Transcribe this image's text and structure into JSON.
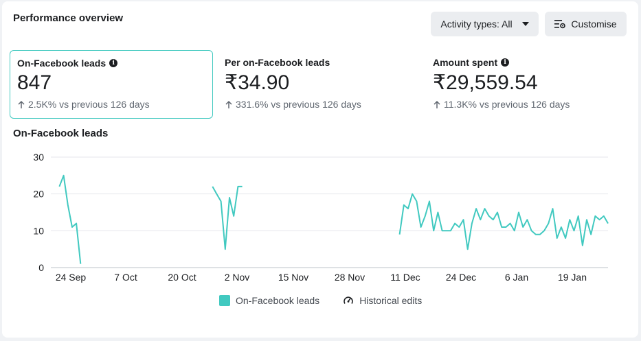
{
  "header": {
    "title": "Performance overview",
    "activity_label": "Activity types: All",
    "customise_label": "Customise"
  },
  "metrics": [
    {
      "label": "On-Facebook leads",
      "value": "847",
      "delta": "2.5K% vs previous 126 days",
      "info": true
    },
    {
      "label": "Per on-Facebook leads",
      "value": "₹34.90",
      "delta": "331.6% vs previous 126 days",
      "info": false
    },
    {
      "label": "Amount spent",
      "value": "₹29,559.54",
      "delta": "11.3K% vs previous 126 days",
      "info": true
    }
  ],
  "chart_title": "On-Facebook leads",
  "legend": {
    "series_label": "On-Facebook leads",
    "edits_label": "Historical edits"
  },
  "colors": {
    "line": "#41c9c0",
    "grid": "#e4e6eb",
    "axis_text": "#1c1e21"
  },
  "chart_data": {
    "type": "line",
    "ylim": [
      0,
      30
    ],
    "yticks": [
      0,
      10,
      20,
      30
    ],
    "xticks": [
      "24 Sep",
      "7 Oct",
      "20 Oct",
      "2 Nov",
      "15 Nov",
      "28 Nov",
      "11 Dec",
      "24 Dec",
      "6 Jan",
      "19 Jan"
    ],
    "grid": true,
    "series": [
      {
        "name": "On-Facebook leads",
        "segments": [
          [
            [
              "2023-09-20",
              22
            ],
            [
              "2023-09-21",
              25
            ],
            [
              "2023-09-22",
              17
            ],
            [
              "2023-09-23",
              11
            ],
            [
              "2023-09-24",
              12
            ],
            [
              "2023-09-25",
              1
            ]
          ],
          [
            [
              "2023-10-26",
              22
            ],
            [
              "2023-10-27",
              20
            ],
            [
              "2023-10-28",
              18
            ],
            [
              "2023-10-29",
              5
            ],
            [
              "2023-10-30",
              19
            ],
            [
              "2023-10-31",
              14
            ],
            [
              "2023-11-01",
              22
            ],
            [
              "2023-11-02",
              22
            ]
          ],
          [
            [
              "2023-12-09",
              9
            ],
            [
              "2023-12-10",
              17
            ],
            [
              "2023-12-11",
              16
            ],
            [
              "2023-12-12",
              20
            ],
            [
              "2023-12-13",
              18
            ],
            [
              "2023-12-14",
              11
            ],
            [
              "2023-12-15",
              14
            ],
            [
              "2023-12-16",
              18
            ],
            [
              "2023-12-17",
              10
            ],
            [
              "2023-12-18",
              15
            ],
            [
              "2023-12-19",
              10
            ],
            [
              "2023-12-20",
              10
            ],
            [
              "2023-12-21",
              10
            ],
            [
              "2023-12-22",
              12
            ],
            [
              "2023-12-23",
              11
            ],
            [
              "2023-12-24",
              13
            ],
            [
              "2023-12-25",
              5
            ],
            [
              "2023-12-26",
              12
            ],
            [
              "2023-12-27",
              16
            ],
            [
              "2023-12-28",
              13
            ],
            [
              "2023-12-29",
              16
            ],
            [
              "2023-12-30",
              14
            ],
            [
              "2023-12-31",
              13
            ],
            [
              "2024-01-01",
              15
            ],
            [
              "2024-01-02",
              11
            ],
            [
              "2024-01-03",
              11
            ],
            [
              "2024-01-04",
              12
            ],
            [
              "2024-01-05",
              10
            ],
            [
              "2024-01-06",
              15
            ],
            [
              "2024-01-07",
              11
            ],
            [
              "2024-01-08",
              13
            ],
            [
              "2024-01-09",
              10
            ],
            [
              "2024-01-10",
              9
            ],
            [
              "2024-01-11",
              9
            ],
            [
              "2024-01-12",
              10
            ],
            [
              "2024-01-13",
              12
            ],
            [
              "2024-01-14",
              16
            ],
            [
              "2024-01-15",
              8
            ],
            [
              "2024-01-16",
              11
            ],
            [
              "2024-01-17",
              8
            ],
            [
              "2024-01-18",
              13
            ],
            [
              "2024-01-19",
              10
            ],
            [
              "2024-01-20",
              14
            ],
            [
              "2024-01-21",
              6
            ],
            [
              "2024-01-22",
              13
            ],
            [
              "2024-01-23",
              9
            ],
            [
              "2024-01-24",
              14
            ],
            [
              "2024-01-25",
              13
            ],
            [
              "2024-01-26",
              14
            ],
            [
              "2024-01-27",
              12
            ]
          ]
        ]
      }
    ]
  }
}
